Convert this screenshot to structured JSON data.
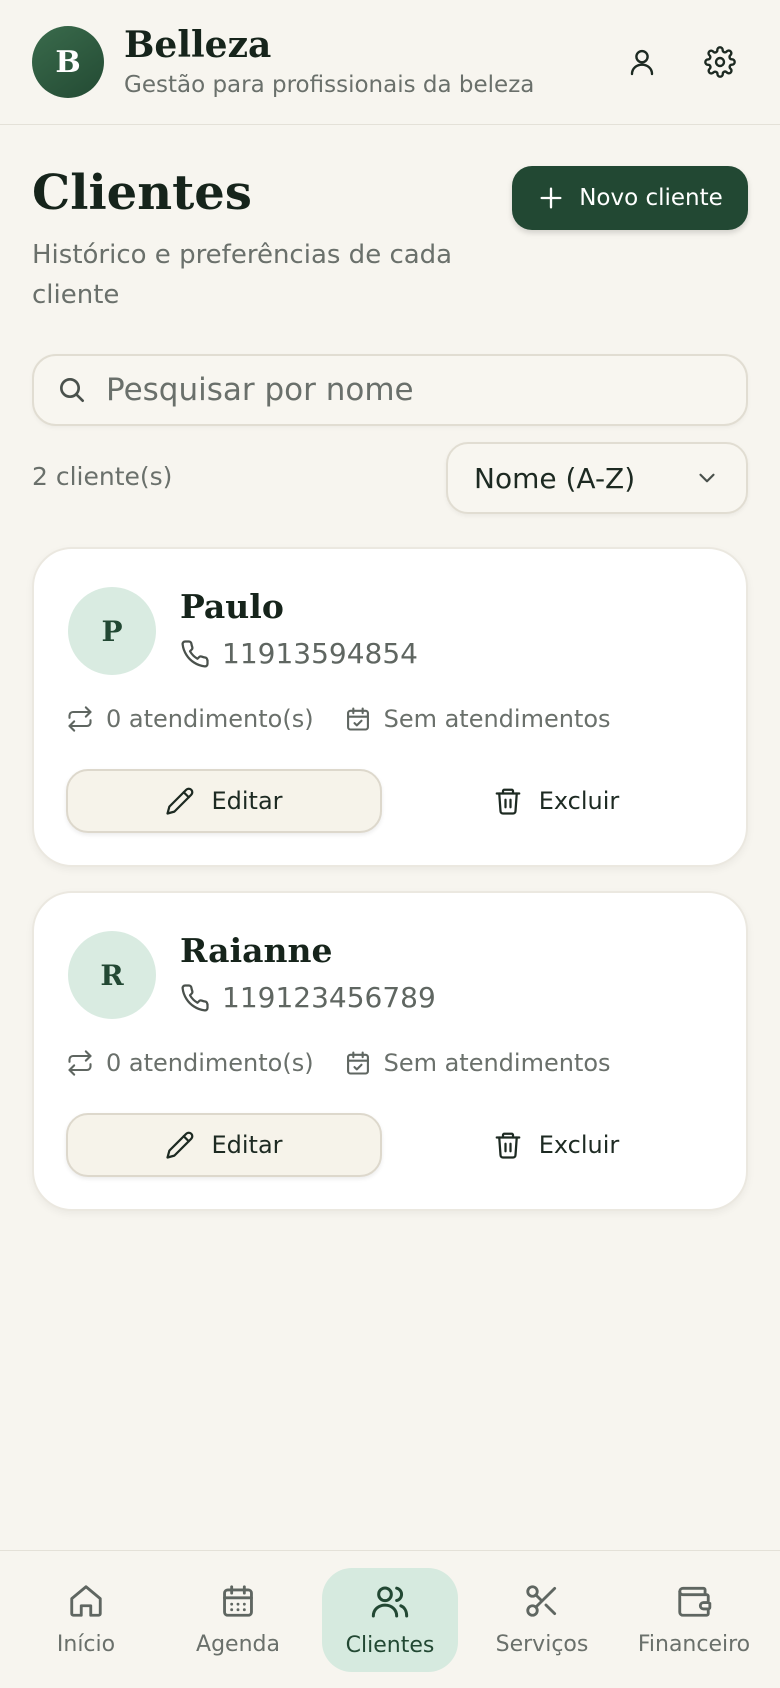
{
  "app": {
    "logo_letter": "B",
    "name": "Belleza",
    "tagline": "Gestão para profissionais da beleza"
  },
  "header_icons": [
    "user-icon",
    "gear-icon"
  ],
  "page": {
    "title": "Clientes",
    "subtitle": "Histórico e preferências de cada cliente",
    "new_button": "Novo cliente"
  },
  "search": {
    "placeholder": "Pesquisar por nome",
    "value": ""
  },
  "list": {
    "count": "2 cliente(s)",
    "sort": "Nome (A-Z)"
  },
  "clients": [
    {
      "initial": "P",
      "name": "Paulo",
      "phone": "11913594854",
      "visits": "0 atendimento(s)",
      "last_visit": "Sem atendimentos",
      "edit": "Editar",
      "delete": "Excluir"
    },
    {
      "initial": "R",
      "name": "Raianne",
      "phone": "119123456789",
      "visits": "0 atendimento(s)",
      "last_visit": "Sem atendimentos",
      "edit": "Editar",
      "delete": "Excluir"
    }
  ],
  "nav": [
    {
      "label": "Início",
      "icon": "home-icon",
      "active": false
    },
    {
      "label": "Agenda",
      "icon": "calendar-icon",
      "active": false
    },
    {
      "label": "Clientes",
      "icon": "users-icon",
      "active": true
    },
    {
      "label": "Serviços",
      "icon": "scissors-icon",
      "active": false
    },
    {
      "label": "Financeiro",
      "icon": "wallet-icon",
      "active": false
    }
  ],
  "colors": {
    "background": "#f7f5ef",
    "primary": "#224833",
    "accent_soft": "#d6eadf",
    "text": "#16241b",
    "muted": "#6a706b"
  }
}
